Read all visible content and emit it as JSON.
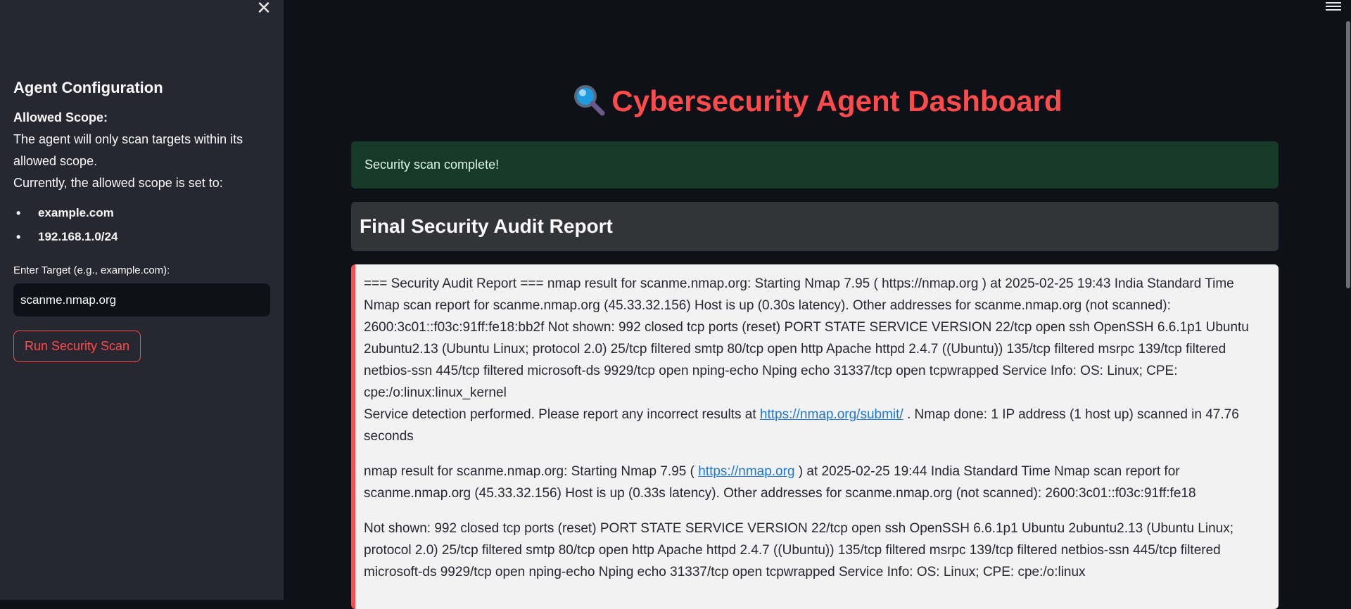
{
  "sidebar": {
    "close_symbol": "✕",
    "title": "Agent Configuration",
    "scope_label": "Allowed Scope:",
    "scope_text_1": "The agent will only scan targets within its allowed scope.",
    "scope_text_2": "Currently, the allowed scope is set to:",
    "scope_items": [
      "example.com",
      "192.168.1.0/24"
    ],
    "target_label": "Enter Target (e.g., example.com):",
    "target_value": "scanme.nmap.org",
    "run_button": "Run Security Scan"
  },
  "main": {
    "title": "Cybersecurity Agent Dashboard",
    "success_message": "Security scan complete!",
    "section_heading": "Final Security Audit Report",
    "report": {
      "p1_a": "=== Security Audit Report === nmap result for scanme.nmap.org: Starting Nmap 7.95 ( https://nmap.org ) at 2025-02-25 19:43 India Standard Time Nmap scan report for scanme.nmap.org (45.33.32.156) Host is up (0.30s latency). Other addresses for scanme.nmap.org (not scanned): 2600:3c01::f03c:91ff:fe18:bb2f Not shown: 992 closed tcp ports (reset) PORT STATE SERVICE VERSION 22/tcp open ssh OpenSSH 6.6.1p1 Ubuntu 2ubuntu2.13 (Ubuntu Linux; protocol 2.0) 25/tcp filtered smtp 80/tcp open http Apache httpd 2.4.7 ((Ubuntu)) 135/tcp filtered msrpc 139/tcp filtered netbios-ssn 445/tcp filtered microsoft-ds 9929/tcp open nping-echo Nping echo 31337/tcp open tcpwrapped Service Info: OS: Linux; CPE: cpe:/o:linux:linux_kernel",
      "p1_b_pre": "Service detection performed. Please report any incorrect results at",
      "p1_b_link": "https://nmap.org/submit/",
      "p1_b_post": ". Nmap done: 1 IP address (1 host up) scanned in 47.76 seconds",
      "p2_pre": "nmap result for scanme.nmap.org: Starting Nmap 7.95 (",
      "p2_link": "https://nmap.org",
      "p2_post": ") at 2025-02-25 19:44 India Standard Time Nmap scan report for scanme.nmap.org (45.33.32.156) Host is up (0.33s latency). Other addresses for scanme.nmap.org (not scanned): 2600:3c01::f03c:91ff:fe18",
      "p3": "Not shown: 992 closed tcp ports (reset) PORT STATE SERVICE VERSION 22/tcp open ssh OpenSSH 6.6.1p1 Ubuntu 2ubuntu2.13 (Ubuntu Linux; protocol 2.0) 25/tcp filtered smtp 80/tcp open http Apache httpd 2.4.7 ((Ubuntu)) 135/tcp filtered msrpc 139/tcp filtered netbios-ssn 445/tcp filtered microsoft-ds 9929/tcp open nping-echo Nping echo 31337/tcp open tcpwrapped Service Info: OS: Linux; CPE: cpe:/o:linux"
    }
  },
  "icons": {
    "title_icon": "magnifying-glass-icon",
    "menu_icon": "hamburger-menu-icon",
    "close_icon": "close-icon"
  },
  "colors": {
    "accent": "#ff4b4b",
    "success_bg": "#173928",
    "link": "#1f77d4"
  }
}
